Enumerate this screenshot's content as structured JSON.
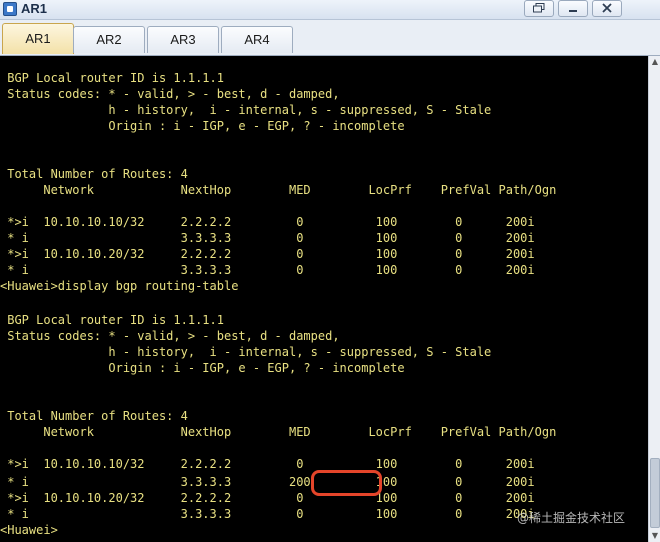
{
  "window": {
    "title": "AR1"
  },
  "tabs": [
    {
      "label": "AR1",
      "active": true
    },
    {
      "label": "AR2",
      "active": false
    },
    {
      "label": "AR3",
      "active": false
    },
    {
      "label": "AR4",
      "active": false
    }
  ],
  "console": {
    "lines": [
      " BGP Local router ID is 1.1.1.1",
      " Status codes: * - valid, > - best, d - damped,",
      "               h - history,  i - internal, s - suppressed, S - Stale",
      "               Origin : i - IGP, e - EGP, ? - incomplete",
      "",
      "",
      " Total Number of Routes: 4",
      "      Network            NextHop        MED        LocPrf    PrefVal Path/Ogn",
      "",
      " *>i  10.10.10.10/32     2.2.2.2         0          100        0      200i",
      " * i                     3.3.3.3         0          100        0      200i",
      " *>i  10.10.10.20/32     2.2.2.2         0          100        0      200i",
      " * i                     3.3.3.3         0          100        0      200i",
      "<Huawei>display bgp routing-table",
      "",
      " BGP Local router ID is 1.1.1.1",
      " Status codes: * - valid, > - best, d - damped,",
      "               h - history,  i - internal, s - suppressed, S - Stale",
      "               Origin : i - IGP, e - EGP, ? - incomplete",
      "",
      "",
      " Total Number of Routes: 4",
      "      Network            NextHop        MED        LocPrf    PrefVal Path/Ogn",
      "",
      " *>i  10.10.10.10/32     2.2.2.2         0          100        0      200i",
      " * i                     3.3.3.3        200         100        0      200i",
      " *>i  10.10.10.20/32     2.2.2.2         0          100        0      200i",
      " * i                     3.3.3.3         0          100        0      200i",
      "<Huawei>"
    ]
  },
  "watermark": "@稀土掘金技术社区",
  "colors": {
    "console_bg": "#000000",
    "console_text": "#e8e082",
    "highlight": "#e4452a",
    "active_tab": "#f3e1a8"
  }
}
